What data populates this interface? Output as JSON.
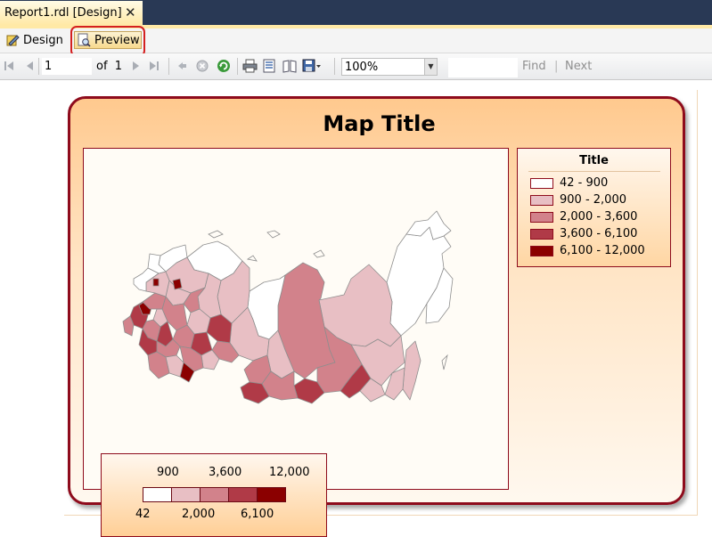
{
  "tab": {
    "title": "Report1.rdl [Design]",
    "close": "✕"
  },
  "modes": {
    "design": "Design",
    "preview": "Preview"
  },
  "toolbar": {
    "page": "1",
    "of_label": "of",
    "total_pages": "1",
    "zoom": "100%",
    "find": "Find",
    "separator": "|",
    "next": "Next"
  },
  "map": {
    "title": "Map Title",
    "legend": {
      "title": "Title",
      "items": [
        {
          "label": "42 - 900",
          "color": "#ffffff"
        },
        {
          "label": "900 - 2,000",
          "color": "#e8bfc4"
        },
        {
          "label": "2,000 - 3,600",
          "color": "#d2828b"
        },
        {
          "label": "3,600 - 6,100",
          "color": "#b03a47"
        },
        {
          "label": "6,100 - 12,000",
          "color": "#8b0000"
        }
      ]
    },
    "color_scale": {
      "top_labels": [
        "900",
        "3,600",
        "12,000"
      ],
      "bottom_labels": [
        "42",
        "2,000",
        "6,100"
      ],
      "colors": [
        "#ffffff",
        "#e8bfc4",
        "#d2828b",
        "#b03a47",
        "#8b0000"
      ]
    }
  },
  "colors": {
    "frame": "#8e0b1c",
    "tabstrip": "#293955",
    "accent": "#ffe9a6",
    "highlight_ring": "#d42020"
  }
}
